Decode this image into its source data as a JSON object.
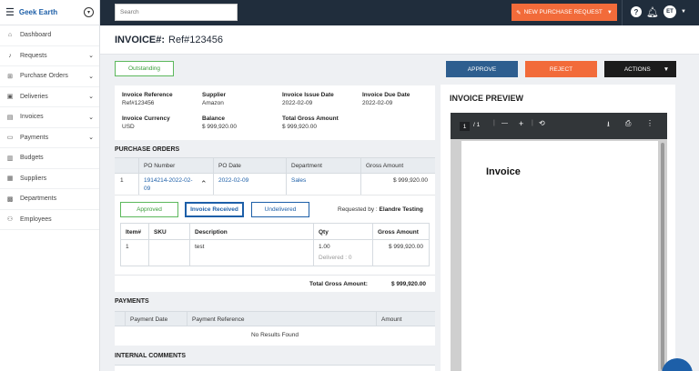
{
  "app": {
    "name": "Geek Earth"
  },
  "sidebar": {
    "items": [
      {
        "label": "Dashboard",
        "icon": "home-icon",
        "chevron": false
      },
      {
        "label": "Requests",
        "icon": "bell-icon",
        "chevron": true
      },
      {
        "label": "Purchase Orders",
        "icon": "cart-icon",
        "chevron": true
      },
      {
        "label": "Deliveries",
        "icon": "box-icon",
        "chevron": true
      },
      {
        "label": "Invoices",
        "icon": "document-icon",
        "chevron": true
      },
      {
        "label": "Payments",
        "icon": "money-icon",
        "chevron": true
      },
      {
        "label": "Budgets",
        "icon": "wallet-icon",
        "chevron": false
      },
      {
        "label": "Suppliers",
        "icon": "truck-icon",
        "chevron": false
      },
      {
        "label": "Departments",
        "icon": "building-icon",
        "chevron": false
      },
      {
        "label": "Employees",
        "icon": "users-icon",
        "chevron": false
      }
    ]
  },
  "topbar": {
    "search_placeholder": "Search",
    "new_request_label": "NEW PURCHASE REQUEST",
    "avatar_initials": "ET"
  },
  "header": {
    "label": "INVOICE#:",
    "ref": "Ref#123456"
  },
  "status": "Outstanding",
  "actions": {
    "approve": "APPROVE",
    "reject": "REJECT",
    "actions": "ACTIONS"
  },
  "info": {
    "invoice_reference": {
      "key": "Invoice Reference",
      "value": "Ref#123456"
    },
    "supplier": {
      "key": "Supplier",
      "value": "Amazon"
    },
    "issue_date": {
      "key": "Invoice Issue Date",
      "value": "2022-02-09"
    },
    "due_date": {
      "key": "Invoice Due Date",
      "value": "2022-02-09"
    },
    "currency": {
      "key": "Invoice Currency",
      "value": "USD"
    },
    "balance": {
      "key": "Balance",
      "value": "$ 999,920.00"
    },
    "total_gross": {
      "key": "Total Gross Amount",
      "value": "$ 999,920.00"
    }
  },
  "purchase_orders": {
    "title": "PURCHASE ORDERS",
    "columns": {
      "po_number": "PO Number",
      "po_date": "PO Date",
      "department": "Department",
      "gross_amount": "Gross Amount"
    },
    "row": {
      "index": "1",
      "po_number_1": "1914214-2022-02-",
      "po_number_2": "09",
      "po_date": "2022-02-09",
      "department": "Sales",
      "gross_amount": "$ 999,920.00"
    },
    "tabs": {
      "approved": "Approved",
      "received": "Invoice Received",
      "undelivered": "Undelivered"
    },
    "requested_label": "Requested by :",
    "requested_by": "Elandre Testing",
    "line_columns": {
      "item": "Item#",
      "sku": "SKU",
      "description": "Description",
      "qty": "Qty",
      "gross": "Gross Amount"
    },
    "line_row": {
      "item": "1",
      "sku": "",
      "description": "test",
      "qty": "1.00",
      "delivered": "Delivered : 0",
      "gross": "$ 999,920.00"
    },
    "total_label": "Total Gross Amount:",
    "total_value": "$ 999,920.00"
  },
  "payments": {
    "title": "PAYMENTS",
    "columns": {
      "date": "Payment Date",
      "reference": "Payment Reference",
      "amount": "Amount"
    },
    "empty": "No Results Found"
  },
  "comments": {
    "title": "INTERNAL COMMENTS"
  },
  "preview": {
    "title": "INVOICE PREVIEW",
    "page_current": "1",
    "page_total": "/ 1",
    "doc_title": "Invoice"
  }
}
